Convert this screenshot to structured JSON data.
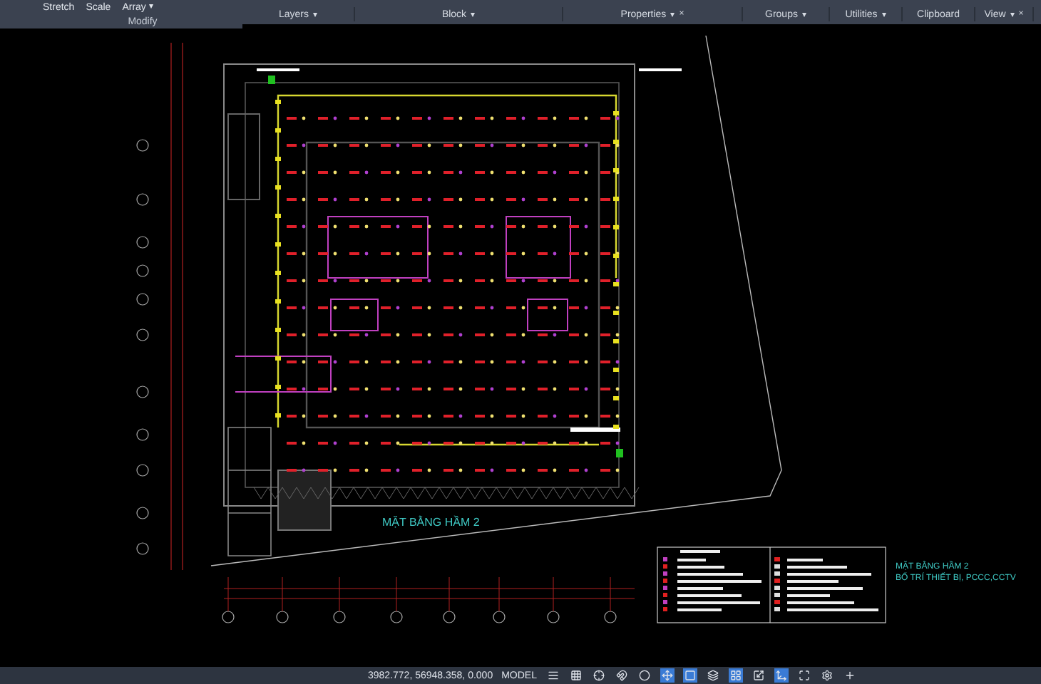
{
  "ribbon": {
    "tools": [
      {
        "label": "Stretch"
      },
      {
        "label": "Scale"
      },
      {
        "label": "Array",
        "caret": "▾"
      }
    ],
    "panels": [
      {
        "label": "Modify"
      },
      {
        "label": "Layers",
        "caret": "▾"
      },
      {
        "label": "Block",
        "caret": "▾"
      },
      {
        "label": "Properties",
        "caret": "▾",
        "close": "×"
      },
      {
        "label": "Groups",
        "caret": "▾"
      },
      {
        "label": "Utilities",
        "caret": "▾"
      },
      {
        "label": "Clipboard"
      },
      {
        "label": "View",
        "caret": "▾",
        "close": "×"
      }
    ]
  },
  "drawing": {
    "plan_title": "MẶT BẰNG HẦM 2",
    "title_block": [
      "MẶT BẰNG HẦM 2",
      "BỐ TRÍ THIẾT BỊ, PCCC,CCTV"
    ]
  },
  "status_bar": {
    "coordinates": "3982.772, 56948.358, 0.000",
    "space": "MODEL"
  }
}
